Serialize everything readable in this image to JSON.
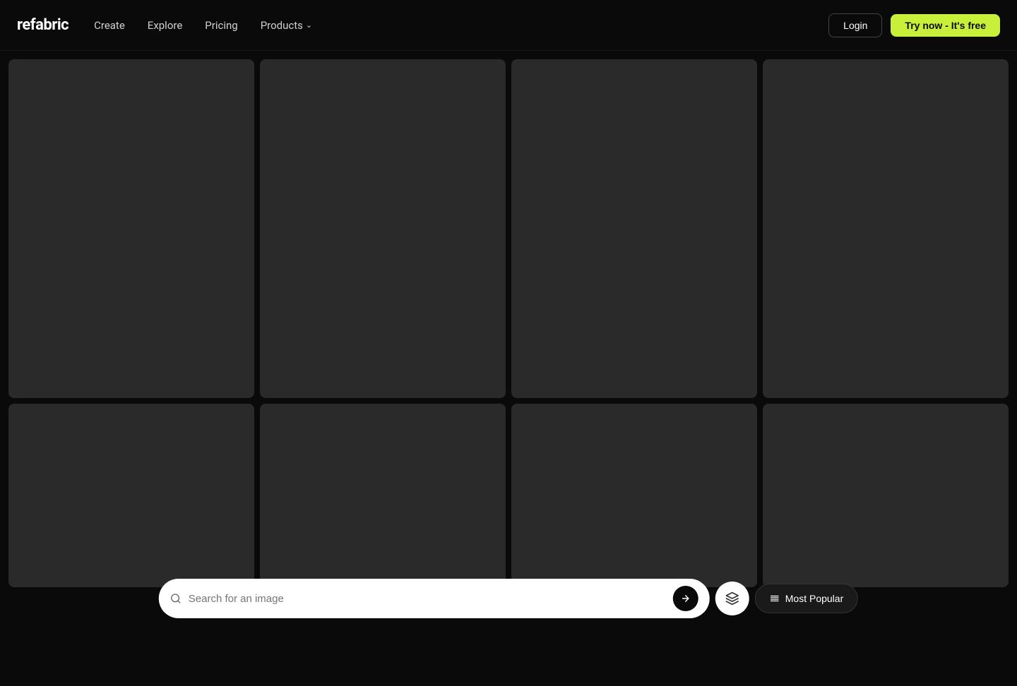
{
  "nav": {
    "logo": "refabric",
    "links": [
      {
        "id": "create",
        "label": "Create"
      },
      {
        "id": "explore",
        "label": "Explore"
      },
      {
        "id": "pricing",
        "label": "Pricing"
      },
      {
        "id": "products",
        "label": "Products",
        "hasChevron": true
      }
    ],
    "login_label": "Login",
    "try_label": "Try now - It's free"
  },
  "grid": {
    "cards_row1": [
      {
        "id": "card-1",
        "height": "tall"
      },
      {
        "id": "card-2",
        "height": "tall"
      },
      {
        "id": "card-3",
        "height": "tall"
      },
      {
        "id": "card-4",
        "height": "tall"
      }
    ],
    "cards_row2": [
      {
        "id": "card-5",
        "height": "medium"
      },
      {
        "id": "card-6",
        "height": "medium"
      },
      {
        "id": "card-7",
        "height": "medium"
      },
      {
        "id": "card-8",
        "height": "medium"
      }
    ]
  },
  "search_bar": {
    "placeholder": "Search for an image",
    "popular_label": "Most Popular",
    "submit_icon": "→",
    "stack_icon": "⊙",
    "sort_icon": "↕"
  }
}
